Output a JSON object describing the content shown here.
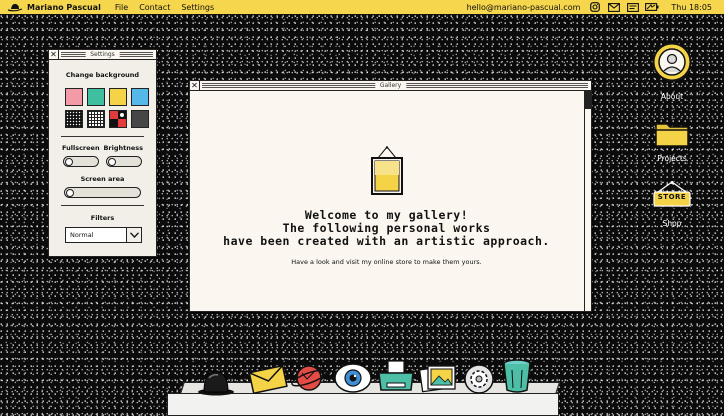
{
  "menubar": {
    "brand": "Mariano Pascual",
    "menus": [
      "File",
      "Contact",
      "Settings"
    ],
    "email": "hello@mariano-pascual.com",
    "status_icons": [
      "instagram-icon",
      "mail-icon",
      "notes-icon",
      "battery-icon"
    ],
    "clock": "Thu 18:05"
  },
  "settings": {
    "title": "Settings",
    "change_background": "Change background",
    "swatch_colors": [
      "#f29aa6",
      "#3fbfa0",
      "#f4d347",
      "#56b8e9"
    ],
    "fullscreen_label": "Fullscreen",
    "brightness_label": "Brightness",
    "screen_area_label": "Screen area",
    "filters_label": "Filters",
    "filter_value": "Normal"
  },
  "gallery": {
    "title": "Gallery",
    "heading_line1": "Welcome to my gallery!",
    "heading_line2": "The following personal works",
    "heading_line3": "have been created with an artistic approach.",
    "subtext": "Have a look and visit my online store to make them yours."
  },
  "desktop_icons": [
    {
      "label": "About",
      "icon": "avatar-icon"
    },
    {
      "label": "Projects",
      "icon": "folder-icon"
    },
    {
      "label": "Shop",
      "icon": "store-sign-icon",
      "sign_text": "STORE"
    }
  ],
  "dock_items": [
    "bowler-hat-icon",
    "envelope-icon",
    "planet-icon",
    "eye-icon",
    "printer-icon",
    "photos-icon",
    "gear-icon",
    "trash-bin-icon"
  ],
  "colors": {
    "menubar_bg": "#f5d64c",
    "accent_yellow": "#f4d347",
    "window_bg": "#fbf7f0"
  }
}
